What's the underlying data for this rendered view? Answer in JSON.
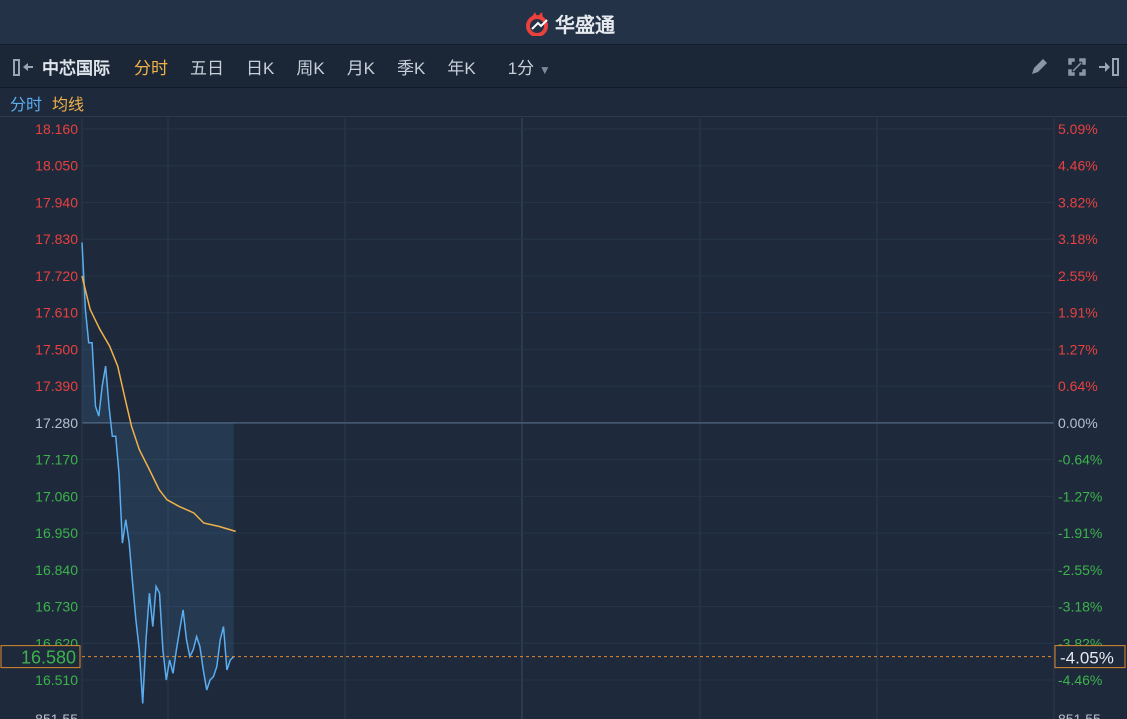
{
  "app": {
    "title": "华盛通"
  },
  "toolbar": {
    "stock_name": "中芯国际",
    "tabs": [
      "分时",
      "五日",
      "日K",
      "周K",
      "月K",
      "季K",
      "年K"
    ],
    "active_tab": 0,
    "interval": "1分"
  },
  "legend": {
    "price_label": "分时",
    "avg_label": "均线"
  },
  "colors": {
    "up": "#e8413e",
    "down": "#3cb34a",
    "price_line": "#5aaef0",
    "avg_line": "#f0b24a",
    "accent": "#f0b24a"
  },
  "chart_data": {
    "type": "line",
    "prev_close": 17.28,
    "ylim": [
      16.4,
      18.16
    ],
    "left_ticks": [
      "18.160",
      "18.050",
      "17.940",
      "17.830",
      "17.720",
      "17.610",
      "17.500",
      "17.390",
      "17.280",
      "17.170",
      "17.060",
      "16.950",
      "16.840",
      "16.730",
      "16.620",
      "16.510"
    ],
    "right_ticks": [
      "5.09%",
      "4.46%",
      "3.82%",
      "3.18%",
      "2.55%",
      "1.91%",
      "1.27%",
      "0.64%",
      "0.00%",
      "-0.64%",
      "-1.27%",
      "-1.91%",
      "-2.55%",
      "-3.18%",
      "-3.82%",
      "-4.46%"
    ],
    "volume_label": "851.55",
    "current_price": "16.580",
    "current_pct": "-4.05%",
    "series": [
      {
        "name": "分时",
        "values": [
          17.82,
          17.62,
          17.52,
          17.52,
          17.33,
          17.3,
          17.39,
          17.45,
          17.33,
          17.24,
          17.24,
          17.125,
          16.92,
          16.99,
          16.92,
          16.8,
          16.69,
          16.6,
          16.44,
          16.63,
          16.77,
          16.67,
          16.79,
          16.77,
          16.6,
          16.51,
          16.57,
          16.53,
          16.6,
          16.66,
          16.72,
          16.63,
          16.58,
          16.6,
          16.64,
          16.61,
          16.54,
          16.48,
          16.51,
          16.52,
          16.55,
          16.63,
          16.67,
          16.54,
          16.57,
          16.58
        ]
      },
      {
        "name": "均线",
        "points": [
          [
            0,
            17.72
          ],
          [
            2.4,
            17.62
          ],
          [
            5.3,
            17.56
          ],
          [
            8.2,
            17.51
          ],
          [
            10.6,
            17.45
          ],
          [
            12.6,
            17.36
          ],
          [
            14.7,
            17.27
          ],
          [
            17,
            17.2
          ],
          [
            20,
            17.14
          ],
          [
            22.9,
            17.08
          ],
          [
            25.2,
            17.05
          ],
          [
            28.8,
            17.03
          ],
          [
            33.2,
            17.01
          ],
          [
            36.1,
            16.98
          ],
          [
            40.6,
            16.97
          ],
          [
            45.6,
            16.955
          ]
        ]
      }
    ]
  }
}
